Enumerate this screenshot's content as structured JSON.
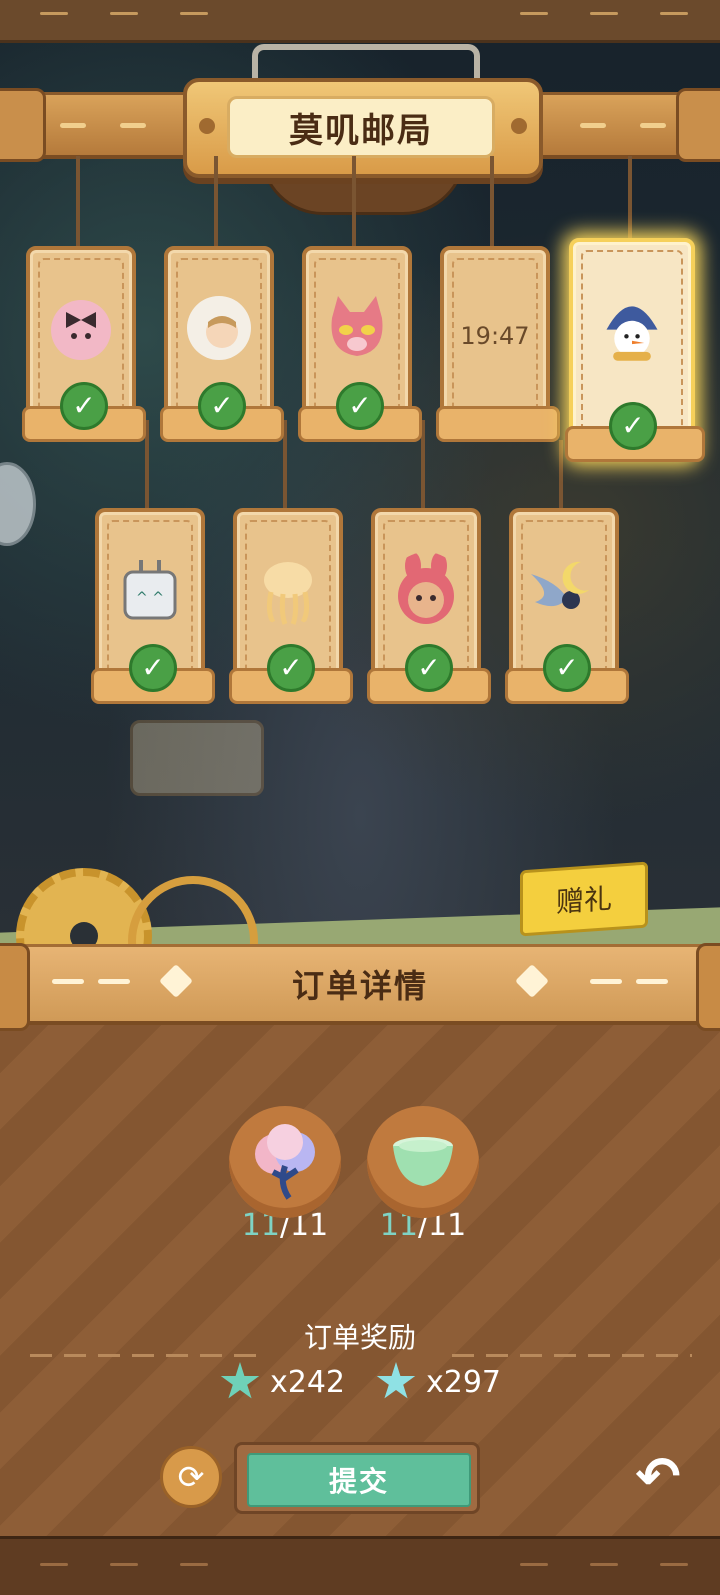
{
  "header": {
    "title": "莫叽邮局"
  },
  "cards": [
    {
      "id": "card-pink-hairbow",
      "completed": true,
      "color": "#f2b8c6"
    },
    {
      "id": "card-white-hood",
      "completed": true,
      "color": "#f4efe6"
    },
    {
      "id": "card-pink-cat",
      "completed": true,
      "color": "#e67a86"
    },
    {
      "id": "card-timer",
      "timer": "19:47",
      "completed": false
    },
    {
      "id": "card-snowman",
      "completed": true,
      "selected": true,
      "color": "#3e5a9e"
    },
    {
      "id": "card-robot",
      "completed": true,
      "color": "#e9ecef"
    },
    {
      "id": "card-jellyfish",
      "completed": true,
      "color": "#f7dca6"
    },
    {
      "id": "card-red-bunny",
      "completed": true,
      "color": "#e26874"
    },
    {
      "id": "card-moon-fish",
      "completed": true,
      "color": "#8fa7c9"
    }
  ],
  "gift_button": {
    "label": "赠礼"
  },
  "order": {
    "title": "订单详情",
    "items": [
      {
        "icon": "cotton-flower-icon",
        "current": "11",
        "total": "/11"
      },
      {
        "icon": "jelly-cup-icon",
        "current": "11",
        "total": "/11"
      }
    ]
  },
  "rewards": {
    "title": "订单奖励",
    "items": [
      {
        "icon": "gem-star-icon",
        "amount": "x242",
        "color": "#6fd1b8"
      },
      {
        "icon": "star-icon",
        "amount": "x297",
        "color": "#8fe1e4"
      }
    ]
  },
  "actions": {
    "submit": "提交",
    "refresh_icon": "refresh-icon",
    "back_icon": "back-arrow-icon"
  }
}
